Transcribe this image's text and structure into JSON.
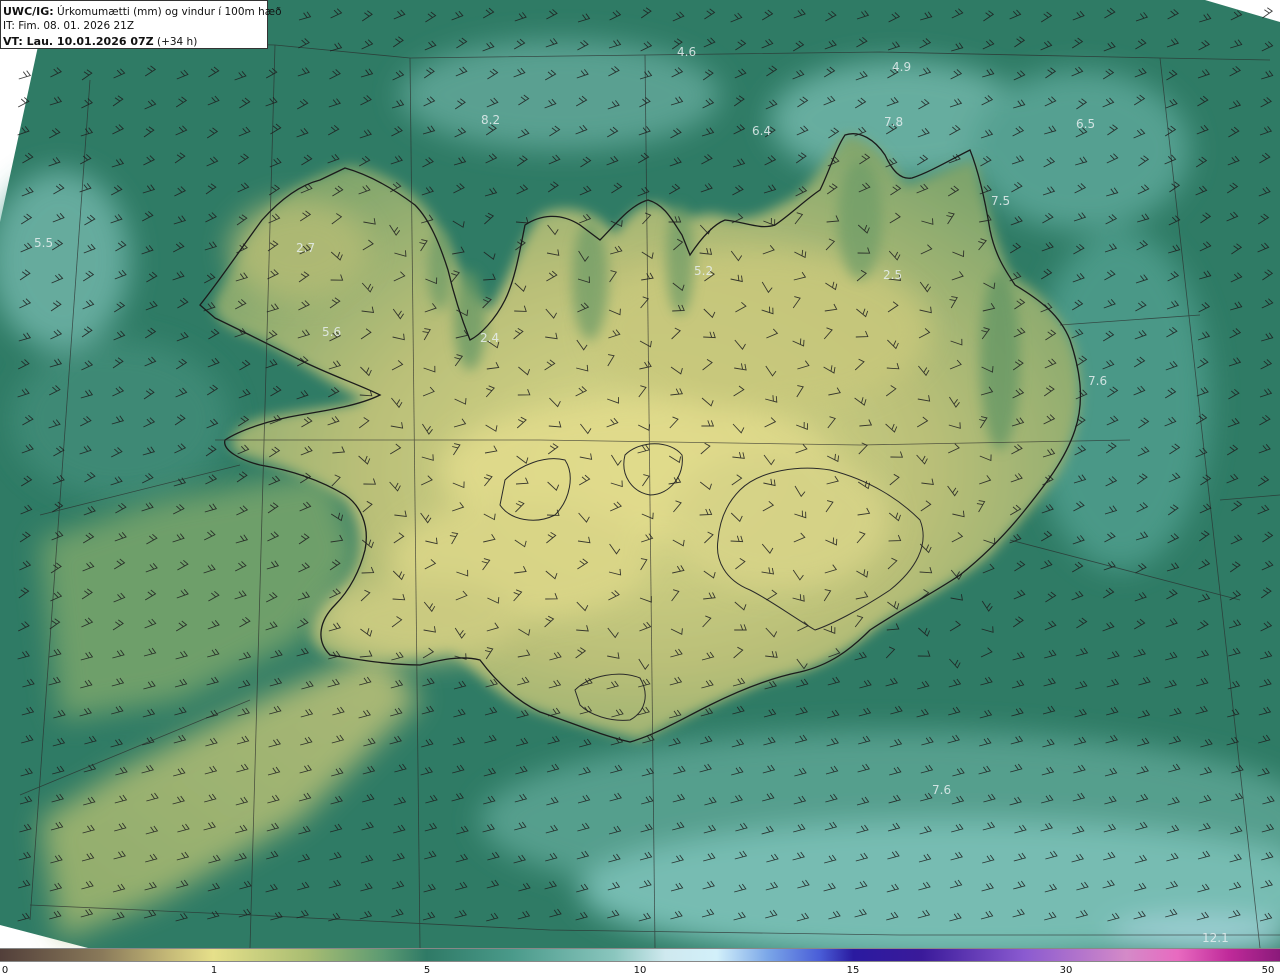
{
  "title_box": {
    "label_bold": "UWC/IG:",
    "label_rest": "Úrkomumætti (mm) og vindur í 100m hæð",
    "init_time": "IT: Fim. 08. 01. 2026 21Z",
    "valid_bold": "VT: Lau. 10.01.2026 07Z",
    "valid_rest": "(+34 h)"
  },
  "colorbar": {
    "ticks": [
      "0",
      "1",
      "5",
      "10",
      "15",
      "30",
      "50"
    ]
  },
  "value_labels": [
    "4.6",
    "4.9",
    "8.2",
    "6.4",
    "7.8",
    "6.5",
    "7.5",
    "5.5",
    "2.7",
    "5.2",
    "2.5",
    "5.6",
    "2.4",
    "7.6",
    "7.6",
    "12.1"
  ],
  "colors": {
    "ocean_dark": "#2c7561",
    "ocean_mid": "#3d8a74",
    "ocean_light": "#6cb4a8",
    "land_low": "#7ca36c",
    "land_mid": "#b6be76",
    "land_high": "#dcd98a",
    "coast": "#1a1a1a"
  }
}
